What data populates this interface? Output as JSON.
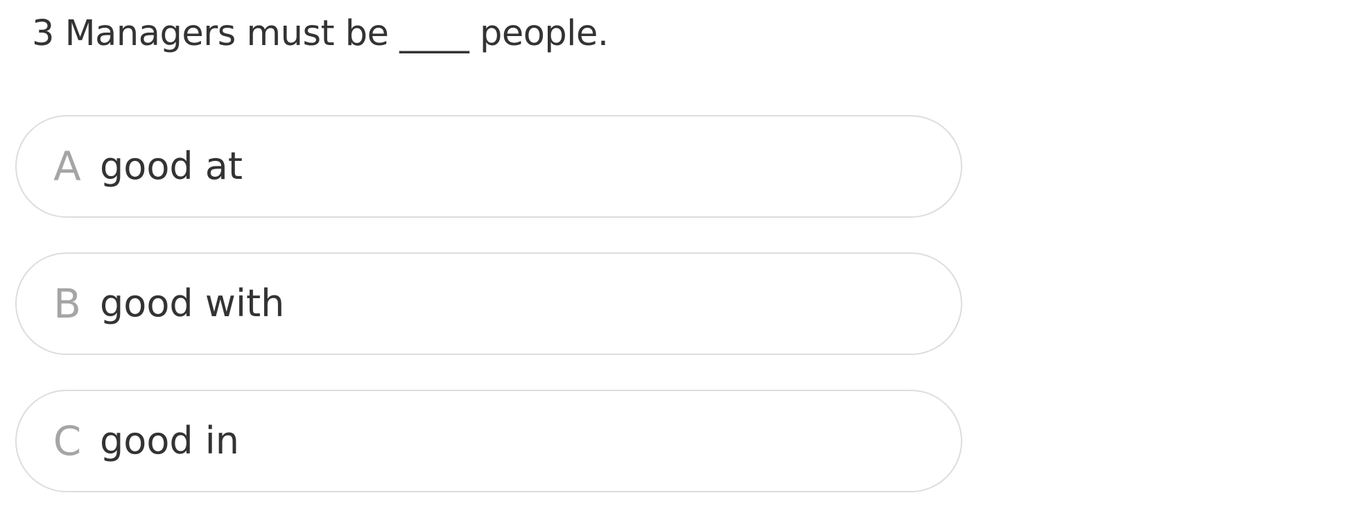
{
  "question": {
    "text": "3 Managers must be ____ people."
  },
  "options": [
    {
      "letter": "A",
      "text": "good at"
    },
    {
      "letter": "B",
      "text": "good with"
    },
    {
      "letter": "C",
      "text": "good in"
    }
  ],
  "colors": {
    "text": "#333333",
    "letter": "#a5a5a5",
    "border": "#dddddd",
    "background": "#ffffff"
  }
}
